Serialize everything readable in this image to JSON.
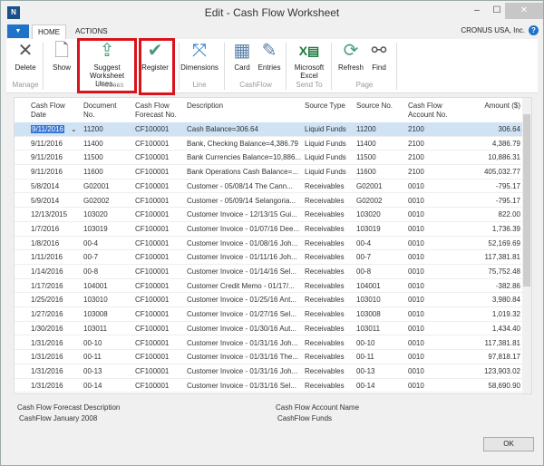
{
  "window": {
    "title": "Edit - Cash Flow Worksheet",
    "company": "CRONUS USA, Inc."
  },
  "tabs": [
    "HOME",
    "ACTIONS"
  ],
  "ribbon": {
    "buttons": [
      {
        "label": "Delete",
        "icon": "delete-x-icon"
      },
      {
        "label": "Show",
        "icon": "document-search-icon"
      },
      {
        "label": "Suggest Worksheet Lines...",
        "icon": "suggest-lines-icon"
      },
      {
        "label": "Register",
        "icon": "checkmark-icon"
      },
      {
        "label": "Dimensions",
        "icon": "dimensions-icon"
      },
      {
        "label": "Card",
        "icon": "card-icon"
      },
      {
        "label": "Entries",
        "icon": "entries-icon"
      },
      {
        "label": "Microsoft Excel",
        "icon": "excel-icon"
      },
      {
        "label": "Refresh",
        "icon": "refresh-icon"
      },
      {
        "label": "Find",
        "icon": "binoculars-icon"
      }
    ],
    "groups": [
      "Manage",
      "Process",
      "Line",
      "CashFlow",
      "Send To",
      "Page"
    ],
    "highlight_color": "#d9131b"
  },
  "grid": {
    "headers": [
      "Cash Flow Date",
      "Document No.",
      "Cash Flow Forecast No.",
      "Description",
      "Source Type",
      "Source No.",
      "Cash Flow Account No.",
      "Amount ($)"
    ],
    "rows": [
      [
        "9/11/2016",
        "11200",
        "CF100001",
        "Cash Balance=306.64",
        "Liquid Funds",
        "11200",
        "2100",
        "306.64"
      ],
      [
        "9/11/2016",
        "11400",
        "CF100001",
        "Bank, Checking Balance=4,386.79",
        "Liquid Funds",
        "11400",
        "2100",
        "4,386.79"
      ],
      [
        "9/11/2016",
        "11500",
        "CF100001",
        "Bank Currencies Balance=10,886....",
        "Liquid Funds",
        "11500",
        "2100",
        "10,886.31"
      ],
      [
        "9/11/2016",
        "11600",
        "CF100001",
        "Bank Operations Cash Balance=...",
        "Liquid Funds",
        "11600",
        "2100",
        "405,032.77"
      ],
      [
        "5/8/2014",
        "G02001",
        "CF100001",
        "Customer   - 05/08/14 The Cann...",
        "Receivables",
        "G02001",
        "0010",
        "-795.17"
      ],
      [
        "5/9/2014",
        "G02002",
        "CF100001",
        "Customer   - 05/09/14 Selangoria...",
        "Receivables",
        "G02002",
        "0010",
        "-795.17"
      ],
      [
        "12/13/2015",
        "103020",
        "CF100001",
        "Customer Invoice - 12/13/15 Gui...",
        "Receivables",
        "103020",
        "0010",
        "822.00"
      ],
      [
        "1/7/2016",
        "103019",
        "CF100001",
        "Customer Invoice - 01/07/16 Dee...",
        "Receivables",
        "103019",
        "0010",
        "1,736.39"
      ],
      [
        "1/8/2016",
        "00-4",
        "CF100001",
        "Customer Invoice - 01/08/16 Joh...",
        "Receivables",
        "00-4",
        "0010",
        "52,169.69"
      ],
      [
        "1/11/2016",
        "00-7",
        "CF100001",
        "Customer Invoice - 01/11/16 Joh...",
        "Receivables",
        "00-7",
        "0010",
        "117,381.81"
      ],
      [
        "1/14/2016",
        "00-8",
        "CF100001",
        "Customer Invoice - 01/14/16 Sel...",
        "Receivables",
        "00-8",
        "0010",
        "75,752.48"
      ],
      [
        "1/17/2016",
        "104001",
        "CF100001",
        "Customer Credit Memo - 01/17/...",
        "Receivables",
        "104001",
        "0010",
        "-382.86"
      ],
      [
        "1/25/2016",
        "103010",
        "CF100001",
        "Customer Invoice - 01/25/16 Ant...",
        "Receivables",
        "103010",
        "0010",
        "3,980.84"
      ],
      [
        "1/27/2016",
        "103008",
        "CF100001",
        "Customer Invoice - 01/27/16 Sel...",
        "Receivables",
        "103008",
        "0010",
        "1,019.32"
      ],
      [
        "1/30/2016",
        "103011",
        "CF100001",
        "Customer Invoice - 01/30/16 Aut...",
        "Receivables",
        "103011",
        "0010",
        "1,434.40"
      ],
      [
        "1/31/2016",
        "00-10",
        "CF100001",
        "Customer Invoice - 01/31/16 Joh...",
        "Receivables",
        "00-10",
        "0010",
        "117,381.81"
      ],
      [
        "1/31/2016",
        "00-11",
        "CF100001",
        "Customer Invoice - 01/31/16 The...",
        "Receivables",
        "00-11",
        "0010",
        "97,818.17"
      ],
      [
        "1/31/2016",
        "00-13",
        "CF100001",
        "Customer Invoice - 01/31/16 Joh...",
        "Receivables",
        "00-13",
        "0010",
        "123,903.02"
      ],
      [
        "1/31/2016",
        "00-14",
        "CF100001",
        "Customer Invoice - 01/31/16 Sel...",
        "Receivables",
        "00-14",
        "0010",
        "58,690.90"
      ]
    ]
  },
  "footer": {
    "forecast_desc_label": "Cash Flow Forecast Description",
    "forecast_desc_value": "CashFlow January 2008",
    "account_name_label": "Cash Flow Account Name",
    "account_name_value": "CashFlow Funds",
    "ok_label": "OK"
  }
}
